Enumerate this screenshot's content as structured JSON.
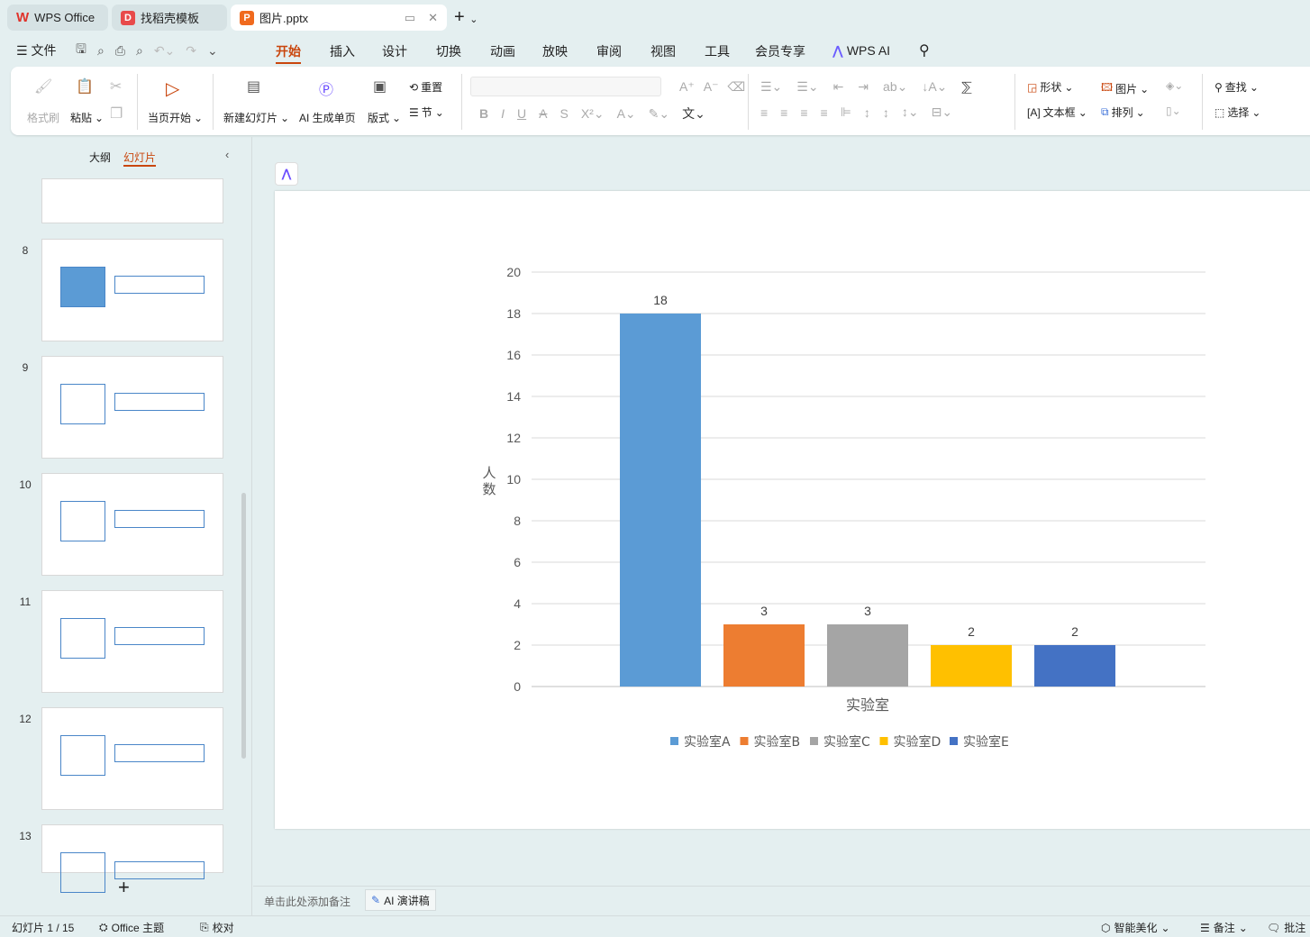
{
  "tabs": [
    {
      "label": "WPS Office",
      "icon": "wps-logo-icon"
    },
    {
      "label": "找稻壳模板",
      "icon": "docer-icon"
    },
    {
      "label": "图片.pptx",
      "icon": "pptx-icon"
    }
  ],
  "menu": {
    "file": "文件",
    "items": [
      "开始",
      "插入",
      "设计",
      "切换",
      "动画",
      "放映",
      "审阅",
      "视图",
      "工具",
      "会员专享"
    ],
    "active": "开始",
    "ai": "WPS AI"
  },
  "ribbon": {
    "format_painter": "格式刷",
    "paste": "粘贴",
    "start_from_current": "当页开始",
    "new_slide": "新建幻灯片",
    "ai_page": "AI 生成单页",
    "layout": "版式",
    "reset": "重置",
    "section": "节",
    "shape": "形状",
    "picture": "图片",
    "textbox": "文本框",
    "arrange": "排列",
    "find": "查找",
    "select": "选择"
  },
  "sidebar": {
    "outline": "大纲",
    "slides": "幻灯片",
    "active": "幻灯片",
    "thumbs": [
      "8",
      "9",
      "10",
      "11",
      "12",
      "13"
    ]
  },
  "notes": {
    "placeholder": "单击此处添加备注",
    "ai_script": "AI 演讲稿"
  },
  "status": {
    "slide": "幻灯片 1 / 15",
    "theme": "Office 主题",
    "proof": "校对",
    "beautify": "智能美化",
    "notes": "备注",
    "comments": "批注"
  },
  "chart_data": {
    "type": "bar",
    "categories": [
      "实验室"
    ],
    "xlabel": "实验室",
    "ylabel": "人数",
    "ylim": [
      0,
      20
    ],
    "yticks": [
      0,
      2,
      4,
      6,
      8,
      10,
      12,
      14,
      16,
      18,
      20
    ],
    "grid": true,
    "legend": "bottom",
    "series": [
      {
        "name": "实验室A",
        "values": [
          18
        ],
        "color": "#5B9BD5"
      },
      {
        "name": "实验室B",
        "values": [
          3
        ],
        "color": "#ED7D31"
      },
      {
        "name": "实验室C",
        "values": [
          3
        ],
        "color": "#A5A5A5"
      },
      {
        "name": "实验室D",
        "values": [
          2
        ],
        "color": "#FFC000"
      },
      {
        "name": "实验室E",
        "values": [
          2
        ],
        "color": "#4472C4"
      }
    ]
  },
  "accent": "#c9460d"
}
